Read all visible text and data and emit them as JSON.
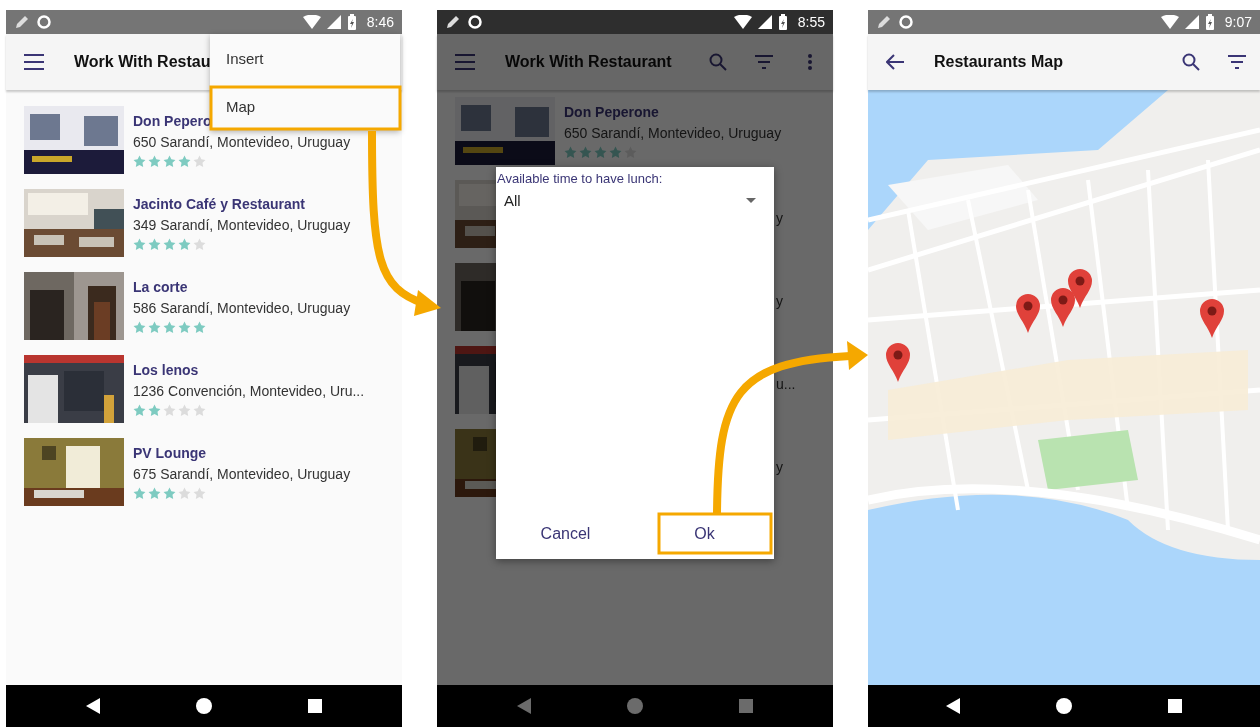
{
  "screens": [
    {
      "status_bar": {
        "time": "8:46"
      },
      "app_bar": {
        "back_button": false,
        "title": "Work With Restau"
      },
      "menu": {
        "items": [
          {
            "label": "Insert"
          },
          {
            "label": "Map"
          }
        ]
      },
      "restaurants": [
        {
          "name": "Don Pepero",
          "address": "650 Sarandí, Montevideo, Uruguay",
          "stars": 4
        },
        {
          "name": "Jacinto Café y Restaurant",
          "address": "349 Sarandí, Montevideo, Uruguay",
          "stars": 4
        },
        {
          "name": "La corte",
          "address": "586 Sarandí, Montevideo, Uruguay",
          "stars": 5
        },
        {
          "name": "Los lenos",
          "address": "1236 Convención, Montevideo, Uru...",
          "stars": 2
        },
        {
          "name": "PV Lounge",
          "address": "675 Sarandí, Montevideo, Uruguay",
          "stars": 3
        }
      ]
    },
    {
      "status_bar": {
        "time": "8:55"
      },
      "dimmed": true,
      "app_bar": {
        "back_button": false,
        "title": "Work With Restaurant",
        "search_button": true,
        "filter_button": true,
        "more_button": true
      },
      "restaurants": [
        {
          "name": "Don Peperone",
          "address": "650 Sarandí, Montevideo, Uruguay",
          "stars": 4
        },
        {
          "tail": "y"
        },
        {
          "tail": "y"
        },
        {
          "tail": "u..."
        },
        {
          "tail": "y"
        }
      ],
      "dialog": {
        "label": "Available time to have lunch:",
        "value": "All",
        "buttons": [
          "Cancel",
          "Ok"
        ]
      }
    },
    {
      "status_bar": {
        "time": "9:07"
      },
      "app_bar": {
        "back_button": true,
        "title": "Restaurants Map",
        "search_button": true,
        "filter_button": true
      }
    }
  ]
}
